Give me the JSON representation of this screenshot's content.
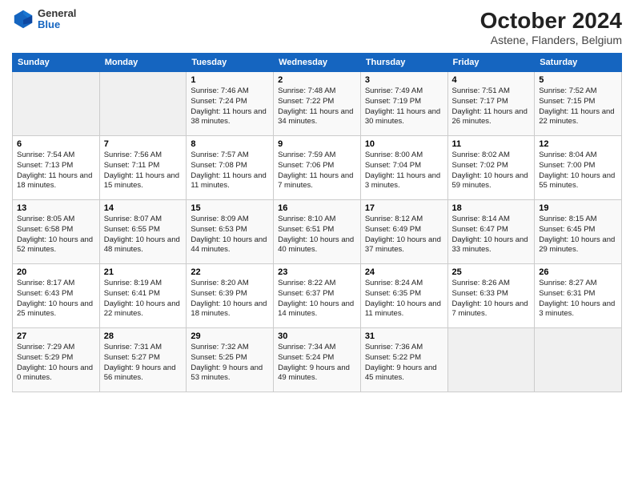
{
  "header": {
    "logo_general": "General",
    "logo_blue": "Blue",
    "month_title": "October 2024",
    "location": "Astene, Flanders, Belgium"
  },
  "days_of_week": [
    "Sunday",
    "Monday",
    "Tuesday",
    "Wednesday",
    "Thursday",
    "Friday",
    "Saturday"
  ],
  "weeks": [
    [
      {
        "day": "",
        "info": ""
      },
      {
        "day": "",
        "info": ""
      },
      {
        "day": "1",
        "info": "Sunrise: 7:46 AM\nSunset: 7:24 PM\nDaylight: 11 hours and 38 minutes."
      },
      {
        "day": "2",
        "info": "Sunrise: 7:48 AM\nSunset: 7:22 PM\nDaylight: 11 hours and 34 minutes."
      },
      {
        "day": "3",
        "info": "Sunrise: 7:49 AM\nSunset: 7:19 PM\nDaylight: 11 hours and 30 minutes."
      },
      {
        "day": "4",
        "info": "Sunrise: 7:51 AM\nSunset: 7:17 PM\nDaylight: 11 hours and 26 minutes."
      },
      {
        "day": "5",
        "info": "Sunrise: 7:52 AM\nSunset: 7:15 PM\nDaylight: 11 hours and 22 minutes."
      }
    ],
    [
      {
        "day": "6",
        "info": "Sunrise: 7:54 AM\nSunset: 7:13 PM\nDaylight: 11 hours and 18 minutes."
      },
      {
        "day": "7",
        "info": "Sunrise: 7:56 AM\nSunset: 7:11 PM\nDaylight: 11 hours and 15 minutes."
      },
      {
        "day": "8",
        "info": "Sunrise: 7:57 AM\nSunset: 7:08 PM\nDaylight: 11 hours and 11 minutes."
      },
      {
        "day": "9",
        "info": "Sunrise: 7:59 AM\nSunset: 7:06 PM\nDaylight: 11 hours and 7 minutes."
      },
      {
        "day": "10",
        "info": "Sunrise: 8:00 AM\nSunset: 7:04 PM\nDaylight: 11 hours and 3 minutes."
      },
      {
        "day": "11",
        "info": "Sunrise: 8:02 AM\nSunset: 7:02 PM\nDaylight: 10 hours and 59 minutes."
      },
      {
        "day": "12",
        "info": "Sunrise: 8:04 AM\nSunset: 7:00 PM\nDaylight: 10 hours and 55 minutes."
      }
    ],
    [
      {
        "day": "13",
        "info": "Sunrise: 8:05 AM\nSunset: 6:58 PM\nDaylight: 10 hours and 52 minutes."
      },
      {
        "day": "14",
        "info": "Sunrise: 8:07 AM\nSunset: 6:55 PM\nDaylight: 10 hours and 48 minutes."
      },
      {
        "day": "15",
        "info": "Sunrise: 8:09 AM\nSunset: 6:53 PM\nDaylight: 10 hours and 44 minutes."
      },
      {
        "day": "16",
        "info": "Sunrise: 8:10 AM\nSunset: 6:51 PM\nDaylight: 10 hours and 40 minutes."
      },
      {
        "day": "17",
        "info": "Sunrise: 8:12 AM\nSunset: 6:49 PM\nDaylight: 10 hours and 37 minutes."
      },
      {
        "day": "18",
        "info": "Sunrise: 8:14 AM\nSunset: 6:47 PM\nDaylight: 10 hours and 33 minutes."
      },
      {
        "day": "19",
        "info": "Sunrise: 8:15 AM\nSunset: 6:45 PM\nDaylight: 10 hours and 29 minutes."
      }
    ],
    [
      {
        "day": "20",
        "info": "Sunrise: 8:17 AM\nSunset: 6:43 PM\nDaylight: 10 hours and 25 minutes."
      },
      {
        "day": "21",
        "info": "Sunrise: 8:19 AM\nSunset: 6:41 PM\nDaylight: 10 hours and 22 minutes."
      },
      {
        "day": "22",
        "info": "Sunrise: 8:20 AM\nSunset: 6:39 PM\nDaylight: 10 hours and 18 minutes."
      },
      {
        "day": "23",
        "info": "Sunrise: 8:22 AM\nSunset: 6:37 PM\nDaylight: 10 hours and 14 minutes."
      },
      {
        "day": "24",
        "info": "Sunrise: 8:24 AM\nSunset: 6:35 PM\nDaylight: 10 hours and 11 minutes."
      },
      {
        "day": "25",
        "info": "Sunrise: 8:26 AM\nSunset: 6:33 PM\nDaylight: 10 hours and 7 minutes."
      },
      {
        "day": "26",
        "info": "Sunrise: 8:27 AM\nSunset: 6:31 PM\nDaylight: 10 hours and 3 minutes."
      }
    ],
    [
      {
        "day": "27",
        "info": "Sunrise: 7:29 AM\nSunset: 5:29 PM\nDaylight: 10 hours and 0 minutes."
      },
      {
        "day": "28",
        "info": "Sunrise: 7:31 AM\nSunset: 5:27 PM\nDaylight: 9 hours and 56 minutes."
      },
      {
        "day": "29",
        "info": "Sunrise: 7:32 AM\nSunset: 5:25 PM\nDaylight: 9 hours and 53 minutes."
      },
      {
        "day": "30",
        "info": "Sunrise: 7:34 AM\nSunset: 5:24 PM\nDaylight: 9 hours and 49 minutes."
      },
      {
        "day": "31",
        "info": "Sunrise: 7:36 AM\nSunset: 5:22 PM\nDaylight: 9 hours and 45 minutes."
      },
      {
        "day": "",
        "info": ""
      },
      {
        "day": "",
        "info": ""
      }
    ]
  ]
}
